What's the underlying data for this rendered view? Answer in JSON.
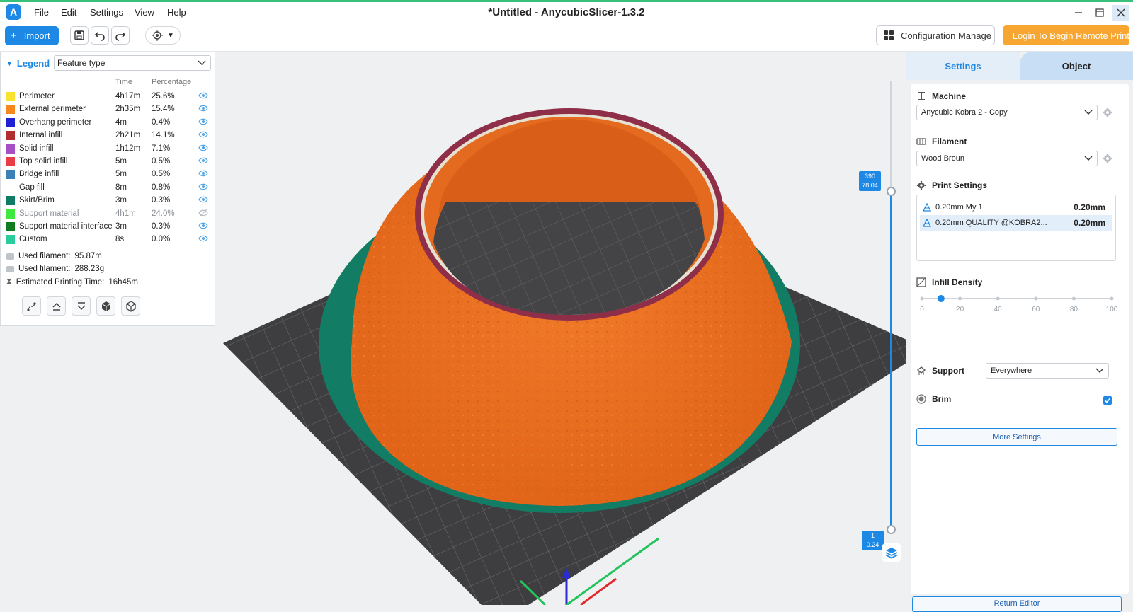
{
  "window": {
    "title": "*Untitled - AnycubicSlicer-1.3.2",
    "logo_letter": "A"
  },
  "menu": [
    "File",
    "Edit",
    "Settings",
    "View",
    "Help"
  ],
  "toolbar": {
    "import_label": "Import",
    "config_manage_label": "Configuration Manage",
    "remote_print_label": "Login To Begin Remote Print"
  },
  "legend": {
    "title": "Legend",
    "type_selected": "Feature type",
    "col_time": "Time",
    "col_percentage": "Percentage",
    "rows": [
      {
        "name": "Perimeter",
        "time": "4h17m",
        "pct": "25.6%",
        "color": "#f9e230",
        "visible": true
      },
      {
        "name": "External perimeter",
        "time": "2h35m",
        "pct": "15.4%",
        "color": "#f7881f",
        "visible": true
      },
      {
        "name": "Overhang perimeter",
        "time": "4m",
        "pct": "0.4%",
        "color": "#1f1fd4",
        "visible": true
      },
      {
        "name": "Internal infill",
        "time": "2h21m",
        "pct": "14.1%",
        "color": "#b22d2d",
        "visible": true
      },
      {
        "name": "Solid infill",
        "time": "1h12m",
        "pct": "7.1%",
        "color": "#a64fc4",
        "visible": true
      },
      {
        "name": "Top solid infill",
        "time": "5m",
        "pct": "0.5%",
        "color": "#ea3c45",
        "visible": true
      },
      {
        "name": "Bridge infill",
        "time": "5m",
        "pct": "0.5%",
        "color": "#3b80b6",
        "visible": true
      },
      {
        "name": "Gap fill",
        "time": "8m",
        "pct": "0.8%",
        "color": "#ffffff",
        "visible": true
      },
      {
        "name": "Skirt/Brim",
        "time": "3m",
        "pct": "0.3%",
        "color": "#0f7b66",
        "visible": true
      },
      {
        "name": "Support material",
        "time": "4h1m",
        "pct": "24.0%",
        "color": "#3ee83e",
        "visible": false
      },
      {
        "name": "Support material interface",
        "time": "3m",
        "pct": "0.3%",
        "color": "#0e7c1f",
        "visible": true
      },
      {
        "name": "Custom",
        "time": "8s",
        "pct": "0.0%",
        "color": "#2bcc9b",
        "visible": true
      }
    ],
    "stats": [
      {
        "label": "Used filament:",
        "value": "95.87m"
      },
      {
        "label": "Used filament:",
        "value": "288.23g"
      },
      {
        "label": "Estimated Printing Time:",
        "value": "16h45m"
      }
    ]
  },
  "layer_slider": {
    "top_layer": "390",
    "top_height": "78.04",
    "bottom_layer": "1",
    "bottom_height": "0.24"
  },
  "panel": {
    "tab_settings": "Settings",
    "tab_object": "Object",
    "machine_title": "Machine",
    "machine_value": "Anycubic Kobra 2 - Copy",
    "filament_title": "Filament",
    "filament_value": "Wood Broun",
    "print_settings_title": "Print Settings",
    "print_items": [
      {
        "name": "0.20mm My 1",
        "value": "0.20mm"
      },
      {
        "name": "0.20mm QUALITY @KOBRA2...",
        "value": "0.20mm"
      }
    ],
    "infill_title": "Infill Density",
    "infill_value": 10,
    "infill_ticks": [
      "0",
      "20",
      "40",
      "60",
      "80",
      "100"
    ],
    "support_title": "Support",
    "support_value": "Everywhere",
    "brim_title": "Brim",
    "brim_checked": true,
    "more_settings_label": "More Settings",
    "return_editor_label": "Return Editor"
  },
  "colors": {
    "accent": "#1e88e5",
    "remote_print": "#f6a631",
    "model_orange": "#ea6e22",
    "brim_teal": "#127c64",
    "bed": "#3e3e40"
  }
}
